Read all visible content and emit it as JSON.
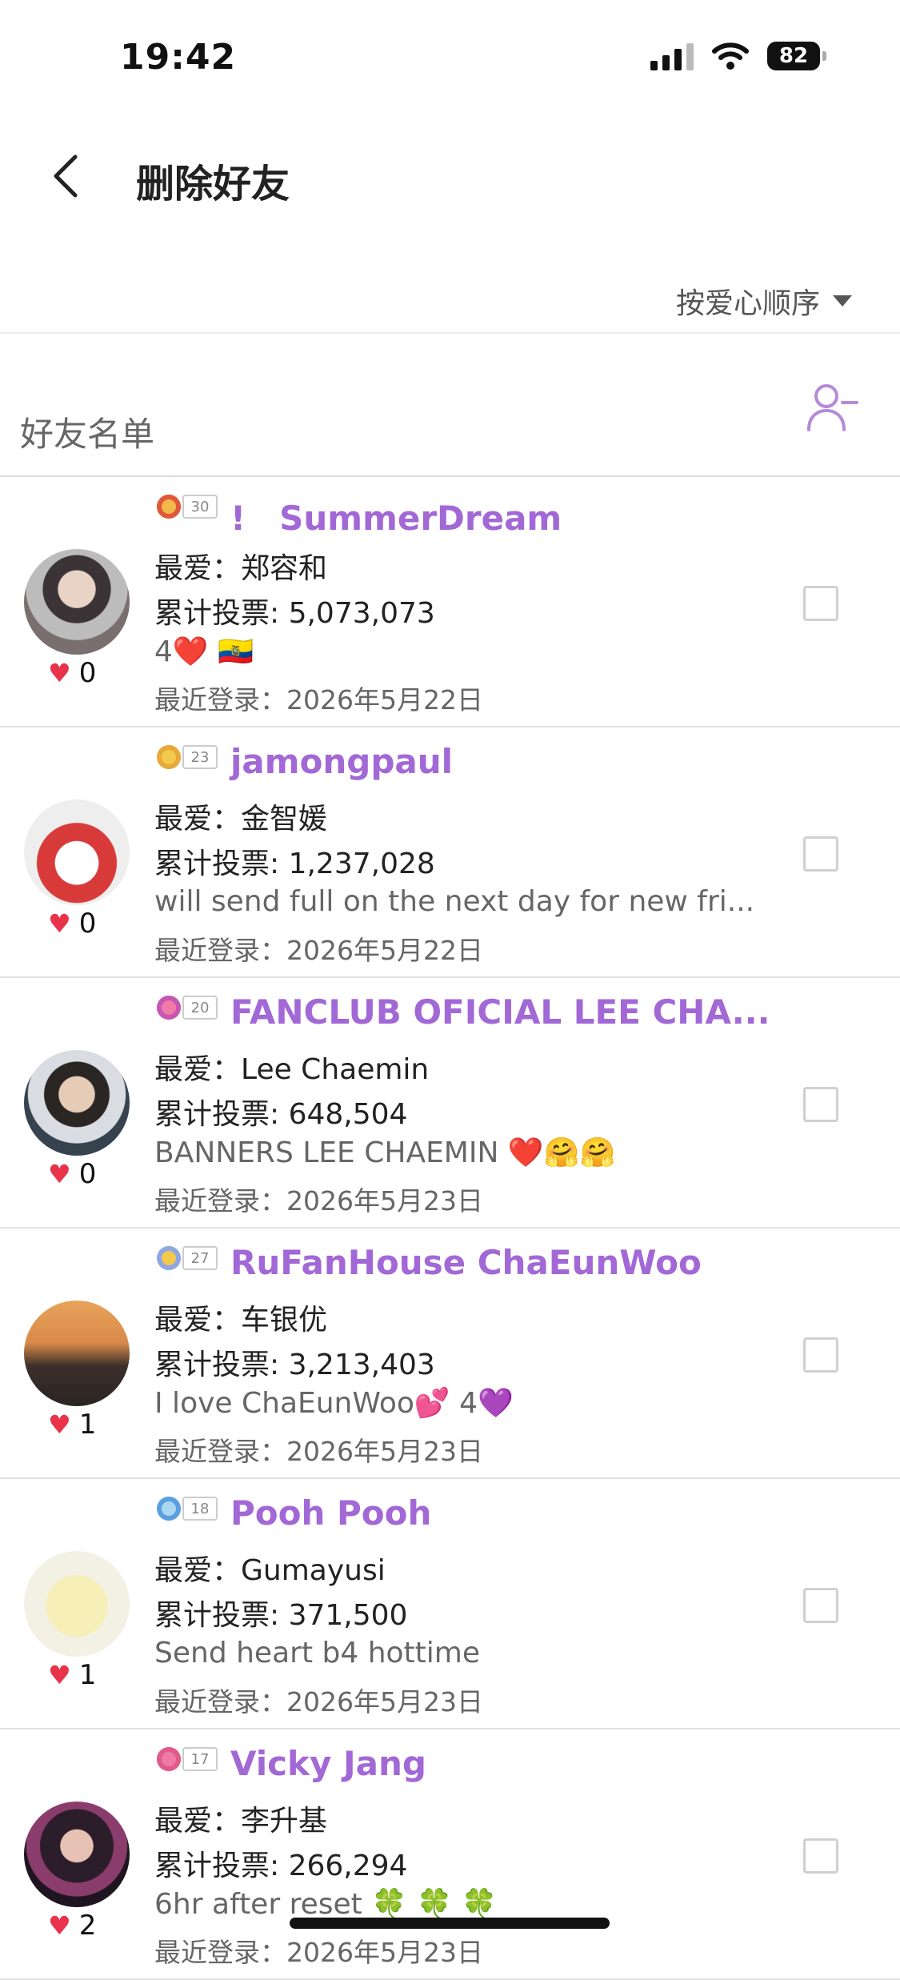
{
  "status_bar": {
    "time": "19:42",
    "battery": "82"
  },
  "header": {
    "title": "删除好友",
    "back_icon": "chevron-left-icon"
  },
  "sort": {
    "label": "按爱心顺序"
  },
  "friends_list": {
    "label": "好友名单",
    "remove_icon": "user-minus-icon"
  },
  "labels": {
    "favorite": "最爱：",
    "votes": "累计投票: ",
    "last_login": "最近登录：",
    "heart_icon": "heart-icon"
  },
  "accent_color": "#a268d6",
  "friends": [
    {
      "level": "30",
      "name": "!　SummerDream",
      "favorite": "郑容和",
      "votes": "5,073,073",
      "status": "4❤️  🇪🇨",
      "last_login": "2026年5月22日",
      "hearts": "0",
      "checked": false
    },
    {
      "level": "23",
      "name": "jamongpaul",
      "favorite": "金智媛",
      "votes": "1,237,028",
      "status": "will send full on the next day for new fri...",
      "last_login": "2026年5月22日",
      "hearts": "0",
      "checked": false
    },
    {
      "level": "20",
      "name": "FANCLUB OFICIAL LEE CHA...",
      "favorite": "Lee Chaemin",
      "votes": "648,504",
      "status": "BANNERS LEE CHAEMIN ❤️🤗🤗",
      "last_login": "2026年5月23日",
      "hearts": "0",
      "checked": false
    },
    {
      "level": "27",
      "name": "RuFanHouse ChaEunWoo",
      "favorite": "车银优",
      "votes": "3,213,403",
      "status": "I love ChaEunWoo💕  4💜",
      "last_login": "2026年5月23日",
      "hearts": "1",
      "checked": false
    },
    {
      "level": "18",
      "name": "Pooh Pooh",
      "favorite": "Gumayusi",
      "votes": "371,500",
      "status": "Send heart b4 hottime",
      "last_login": "2026年5月23日",
      "hearts": "1",
      "checked": false
    },
    {
      "level": "17",
      "name": "Vicky Jang",
      "favorite": "李升基",
      "votes": "266,294",
      "status": "6hr after reset 🍀 🍀 🍀",
      "last_login": "2026年5月23日",
      "hearts": "2",
      "checked": false
    }
  ]
}
